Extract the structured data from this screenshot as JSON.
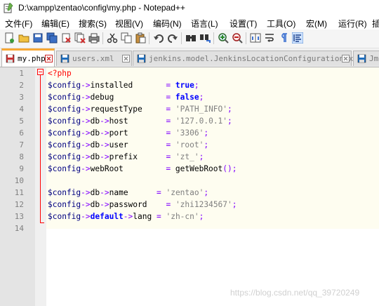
{
  "window": {
    "title": "D:\\xampp\\zentao\\config\\my.php - Notepad++"
  },
  "menu": [
    "文件(F)",
    "编辑(E)",
    "搜索(S)",
    "视图(V)",
    "编码(N)",
    "语言(L)",
    "设置(T)",
    "工具(O)",
    "宏(M)",
    "运行(R)",
    "插"
  ],
  "toolbar": {
    "buttons": [
      "new-file-icon",
      "open-file-icon",
      "save-icon",
      "save-all-icon",
      "close-icon",
      "close-all-icon",
      "print-icon",
      "cut-icon",
      "copy-icon",
      "paste-icon",
      "undo-icon",
      "redo-icon",
      "find-icon",
      "replace-icon",
      "zoom-in-icon",
      "zoom-out-icon",
      "sync-scroll-icon",
      "word-wrap-icon",
      "show-all-chars-icon",
      "indent-guide-icon"
    ]
  },
  "tabs": [
    {
      "label": "my.php",
      "active": true,
      "color": "#cc3333"
    },
    {
      "label": "users.xml",
      "active": false,
      "color": "#1f6fbf"
    },
    {
      "label": "jenkins.model.JenkinsLocationConfiguration.xml",
      "active": false,
      "color": "#1f6fbf"
    },
    {
      "label": "Jmete",
      "active": false,
      "color": "#1f6fbf"
    }
  ],
  "editor": {
    "line_numbers": [
      "1",
      "2",
      "3",
      "4",
      "5",
      "6",
      "7",
      "8",
      "9",
      "10",
      "11",
      "12",
      "13",
      "14"
    ],
    "lines": [
      [
        {
          "t": "<?php",
          "c": "php"
        }
      ],
      [
        {
          "t": "$config",
          "c": "var"
        },
        {
          "t": "->",
          "c": "op"
        },
        {
          "t": "installed       ",
          "c": "plain"
        },
        {
          "t": "=",
          "c": "op"
        },
        {
          "t": " ",
          "c": "plain"
        },
        {
          "t": "true",
          "c": "kw"
        },
        {
          "t": ";",
          "c": "op"
        }
      ],
      [
        {
          "t": "$config",
          "c": "var"
        },
        {
          "t": "->",
          "c": "op"
        },
        {
          "t": "debug           ",
          "c": "plain"
        },
        {
          "t": "=",
          "c": "op"
        },
        {
          "t": " ",
          "c": "plain"
        },
        {
          "t": "false",
          "c": "kw"
        },
        {
          "t": ";",
          "c": "op"
        }
      ],
      [
        {
          "t": "$config",
          "c": "var"
        },
        {
          "t": "->",
          "c": "op"
        },
        {
          "t": "requestType     ",
          "c": "plain"
        },
        {
          "t": "=",
          "c": "op"
        },
        {
          "t": " ",
          "c": "plain"
        },
        {
          "t": "'PATH_INFO'",
          "c": "str"
        },
        {
          "t": ";",
          "c": "op"
        }
      ],
      [
        {
          "t": "$config",
          "c": "var"
        },
        {
          "t": "->",
          "c": "op"
        },
        {
          "t": "db",
          "c": "plain"
        },
        {
          "t": "->",
          "c": "op"
        },
        {
          "t": "host        ",
          "c": "plain"
        },
        {
          "t": "=",
          "c": "op"
        },
        {
          "t": " ",
          "c": "plain"
        },
        {
          "t": "'127.0.0.1'",
          "c": "str"
        },
        {
          "t": ";",
          "c": "op"
        }
      ],
      [
        {
          "t": "$config",
          "c": "var"
        },
        {
          "t": "->",
          "c": "op"
        },
        {
          "t": "db",
          "c": "plain"
        },
        {
          "t": "->",
          "c": "op"
        },
        {
          "t": "port        ",
          "c": "plain"
        },
        {
          "t": "=",
          "c": "op"
        },
        {
          "t": " ",
          "c": "plain"
        },
        {
          "t": "'3306'",
          "c": "str"
        },
        {
          "t": ";",
          "c": "op"
        }
      ],
      [
        {
          "t": "$config",
          "c": "var"
        },
        {
          "t": "->",
          "c": "op"
        },
        {
          "t": "db",
          "c": "plain"
        },
        {
          "t": "->",
          "c": "op"
        },
        {
          "t": "user        ",
          "c": "plain"
        },
        {
          "t": "=",
          "c": "op"
        },
        {
          "t": " ",
          "c": "plain"
        },
        {
          "t": "'root'",
          "c": "str"
        },
        {
          "t": ";",
          "c": "op"
        }
      ],
      [
        {
          "t": "$config",
          "c": "var"
        },
        {
          "t": "->",
          "c": "op"
        },
        {
          "t": "db",
          "c": "plain"
        },
        {
          "t": "->",
          "c": "op"
        },
        {
          "t": "prefix      ",
          "c": "plain"
        },
        {
          "t": "=",
          "c": "op"
        },
        {
          "t": " ",
          "c": "plain"
        },
        {
          "t": "'zt_'",
          "c": "str"
        },
        {
          "t": ";",
          "c": "op"
        }
      ],
      [
        {
          "t": "$config",
          "c": "var"
        },
        {
          "t": "->",
          "c": "op"
        },
        {
          "t": "webRoot         ",
          "c": "plain"
        },
        {
          "t": "=",
          "c": "op"
        },
        {
          "t": " getWebRoot",
          "c": "plain"
        },
        {
          "t": "();",
          "c": "op"
        }
      ],
      [],
      [
        {
          "t": "$config",
          "c": "var"
        },
        {
          "t": "->",
          "c": "op"
        },
        {
          "t": "db",
          "c": "plain"
        },
        {
          "t": "->",
          "c": "op"
        },
        {
          "t": "name      ",
          "c": "plain"
        },
        {
          "t": "=",
          "c": "op"
        },
        {
          "t": " ",
          "c": "plain"
        },
        {
          "t": "'zentao'",
          "c": "str"
        },
        {
          "t": ";",
          "c": "op"
        }
      ],
      [
        {
          "t": "$config",
          "c": "var"
        },
        {
          "t": "->",
          "c": "op"
        },
        {
          "t": "db",
          "c": "plain"
        },
        {
          "t": "->",
          "c": "op"
        },
        {
          "t": "password    ",
          "c": "plain"
        },
        {
          "t": "=",
          "c": "op"
        },
        {
          "t": " ",
          "c": "plain"
        },
        {
          "t": "'zhi1234567'",
          "c": "str"
        },
        {
          "t": ";",
          "c": "op"
        }
      ],
      [
        {
          "t": "$config",
          "c": "var"
        },
        {
          "t": "->",
          "c": "op"
        },
        {
          "t": "default",
          "c": "kw"
        },
        {
          "t": "->",
          "c": "op"
        },
        {
          "t": "lang ",
          "c": "plain"
        },
        {
          "t": "=",
          "c": "op"
        },
        {
          "t": " ",
          "c": "plain"
        },
        {
          "t": "'zh-cn'",
          "c": "str"
        },
        {
          "t": ";",
          "c": "op"
        }
      ],
      []
    ]
  },
  "watermark": "https://blog.csdn.net/qq_39720249",
  "colors": {
    "variable": "#000080",
    "operator": "#8000ff",
    "php_tag": "#ff0000",
    "string": "#808080",
    "keyword": "#0000ff",
    "active_tab_accent": "#f7a733",
    "current_block_bg": "#fefdf0"
  }
}
